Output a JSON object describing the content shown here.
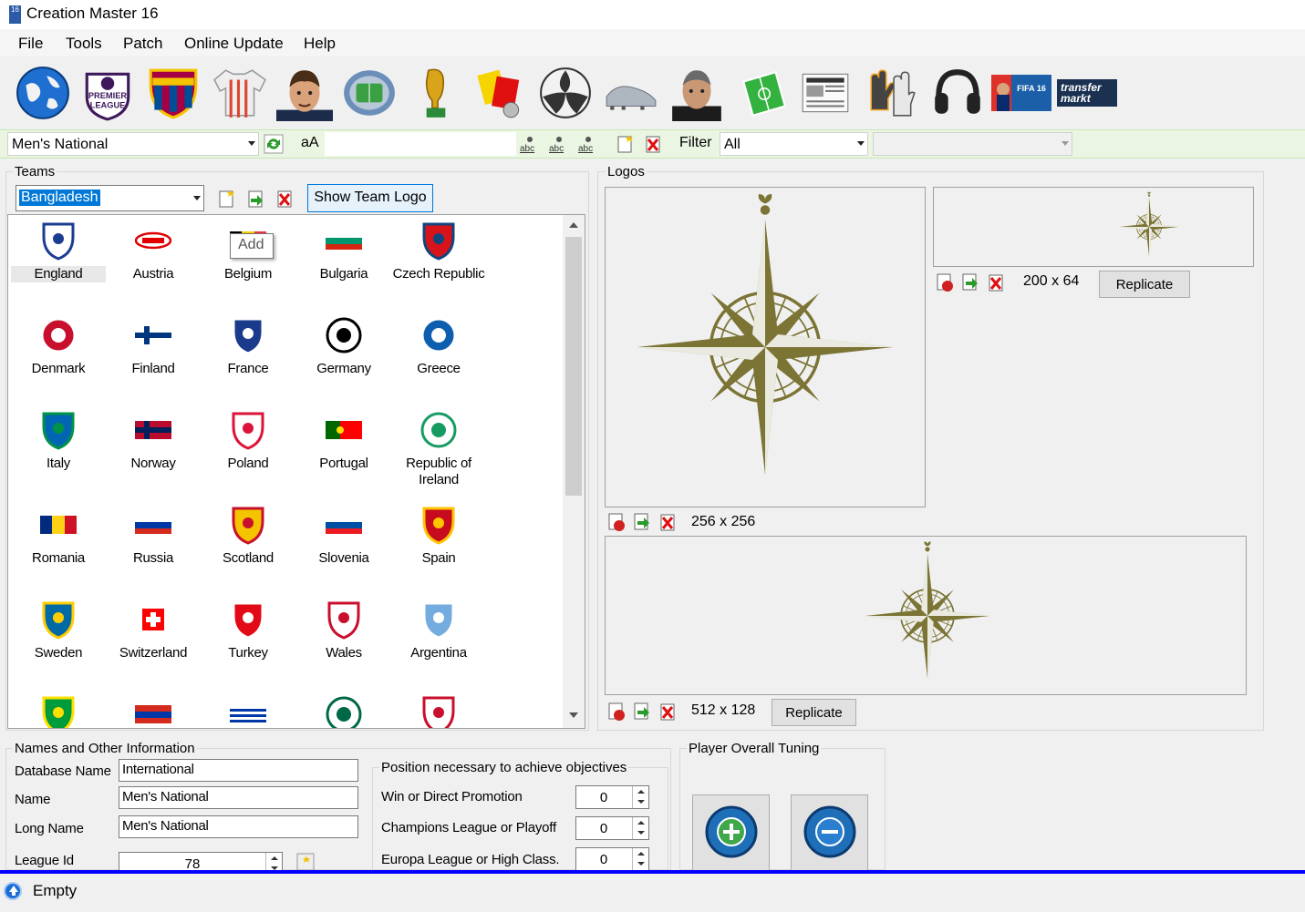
{
  "window": {
    "title": "Creation Master 16",
    "app_icon_text": "16"
  },
  "menu": [
    "File",
    "Tools",
    "Patch",
    "Online Update",
    "Help"
  ],
  "toolbar": {
    "icons": [
      "world-icon",
      "premier-league-icon",
      "fcb-crest-icon",
      "jersey-icon",
      "player-face-icon",
      "stadium-icon",
      "world-cup-trophy-icon",
      "referee-cards-icon",
      "ball-icon",
      "boots-icon",
      "manager-icon",
      "pitch-icon",
      "newspaper-icon",
      "goalkeeper-gloves-icon",
      "headphones-icon",
      "fifa-cover-icon",
      "transfermarkt-icon"
    ],
    "transfermarkt_line1": "transfer",
    "transfermarkt_line2": "markt"
  },
  "filterbar": {
    "league_value": "Men's National",
    "case_label": "aA",
    "filter_label": "Filter",
    "filter_value": "All",
    "second_filter_value": ""
  },
  "teams": {
    "group_label": "Teams",
    "selected": "Bangladesh",
    "show_logo_button": "Show Team Logo",
    "add_tooltip": "Add",
    "list": [
      {
        "name": "England",
        "color": "#ffffff",
        "accent": "#1a3d8f",
        "kind": "crest"
      },
      {
        "name": "Austria",
        "color": "#ffffff",
        "accent": "#e00000",
        "kind": "oval"
      },
      {
        "name": "Belgium",
        "color": "#000000",
        "accent": "#f5d400",
        "kind": "flag3v"
      },
      {
        "name": "Bulgaria",
        "color": "#ffffff",
        "accent": "#00966e",
        "kind": "flag3h",
        "third": "#d62612"
      },
      {
        "name": "Czech Republic",
        "color": "#d7141a",
        "accent": "#11457e",
        "kind": "crest"
      },
      {
        "name": "Denmark",
        "color": "#c8102e",
        "accent": "#ffffff",
        "kind": "round"
      },
      {
        "name": "Finland",
        "color": "#ffffff",
        "accent": "#003580",
        "kind": "cross"
      },
      {
        "name": "France",
        "color": "#1a3b8c",
        "accent": "#ffffff",
        "kind": "crest"
      },
      {
        "name": "Germany",
        "color": "#ffffff",
        "accent": "#000000",
        "kind": "round"
      },
      {
        "name": "Greece",
        "color": "#0d5eaf",
        "accent": "#ffffff",
        "kind": "round"
      },
      {
        "name": "Italy",
        "color": "#0066b3",
        "accent": "#009246",
        "kind": "crest"
      },
      {
        "name": "Norway",
        "color": "#ba0c2f",
        "accent": "#00205b",
        "kind": "cross"
      },
      {
        "name": "Poland",
        "color": "#ffffff",
        "accent": "#dc143c",
        "kind": "crest"
      },
      {
        "name": "Portugal",
        "color": "#006600",
        "accent": "#ff0000",
        "kind": "flag2v"
      },
      {
        "name": "Republic of Ireland",
        "color": "#ffffff",
        "accent": "#169b62",
        "kind": "round"
      },
      {
        "name": "Romania",
        "color": "#002b7f",
        "accent": "#fcd116",
        "kind": "flag3v",
        "third": "#ce1126"
      },
      {
        "name": "Russia",
        "color": "#ffffff",
        "accent": "#0039a6",
        "kind": "flag3h",
        "third": "#d52b1e"
      },
      {
        "name": "Scotland",
        "color": "#f5c400",
        "accent": "#c8102e",
        "kind": "crest"
      },
      {
        "name": "Slovenia",
        "color": "#ffffff",
        "accent": "#0051a4",
        "kind": "flag3h",
        "third": "#ed1c24"
      },
      {
        "name": "Spain",
        "color": "#c60b1e",
        "accent": "#ffc400",
        "kind": "crest"
      },
      {
        "name": "Sweden",
        "color": "#006aa7",
        "accent": "#fecc00",
        "kind": "crest"
      },
      {
        "name": "Switzerland",
        "color": "#ff0000",
        "accent": "#ffffff",
        "kind": "swiss"
      },
      {
        "name": "Turkey",
        "color": "#e30a17",
        "accent": "#ffffff",
        "kind": "crest"
      },
      {
        "name": "Wales",
        "color": "#ffffff",
        "accent": "#c8102e",
        "kind": "crest"
      },
      {
        "name": "Argentina",
        "color": "#74acdf",
        "accent": "#ffffff",
        "kind": "crest"
      },
      {
        "name": "",
        "color": "#009c3b",
        "accent": "#ffdf00",
        "kind": "crest"
      },
      {
        "name": "",
        "color": "#d52b1e",
        "accent": "#0038a8",
        "kind": "flag3h",
        "third": "#d52b1e"
      },
      {
        "name": "",
        "color": "#ffffff",
        "accent": "#0038a8",
        "kind": "stripes"
      },
      {
        "name": "",
        "color": "#ffffff",
        "accent": "#006847",
        "kind": "round"
      },
      {
        "name": "",
        "color": "#ffffff",
        "accent": "#c8102e",
        "kind": "crest"
      }
    ]
  },
  "logos": {
    "group_label": "Logos",
    "large_size": "256 x 256",
    "small_size": "200 x 64",
    "wide_size": "512 x 128",
    "replicate_label": "Replicate",
    "compass_color": "#7b7434"
  },
  "info": {
    "group_label": "Names and Other Information",
    "database_name_label": "Database Name",
    "database_name_value": "International",
    "name_label": "Name",
    "name_value": "Men's National",
    "long_name_label": "Long Name",
    "long_name_value": "Men's National",
    "league_id_label": "League Id",
    "league_id_value": "78"
  },
  "objectives": {
    "group_label": "Position necessary to achieve objectives",
    "rows": [
      {
        "label": "Win or Direct Promotion",
        "value": "0"
      },
      {
        "label": "Champions League or Playoff",
        "value": "0"
      },
      {
        "label": "Europa League or High Class.",
        "value": "0"
      }
    ]
  },
  "tuning": {
    "group_label": "Player Overall Tuning"
  },
  "status": {
    "text": "Empty"
  }
}
